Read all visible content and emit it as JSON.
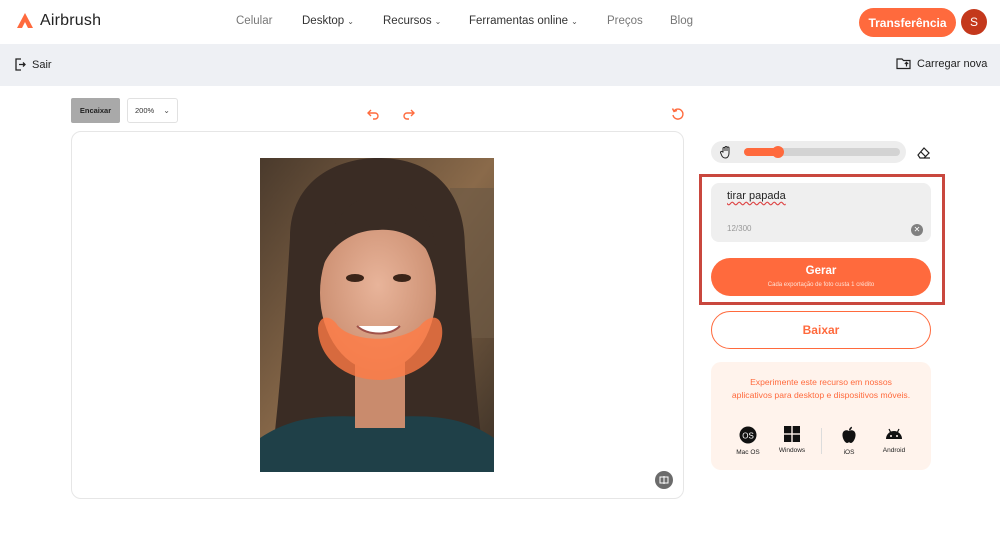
{
  "brand": {
    "name": "Airbrush",
    "color": "#ff6a3d"
  },
  "nav": {
    "items": [
      {
        "label": "Celular",
        "dropdown": false,
        "muted": true
      },
      {
        "label": "Desktop",
        "dropdown": true,
        "muted": false
      },
      {
        "label": "Recursos",
        "dropdown": true,
        "muted": false
      },
      {
        "label": "Ferramentas online",
        "dropdown": true,
        "muted": false
      },
      {
        "label": "Preços",
        "dropdown": false,
        "muted": true
      },
      {
        "label": "Blog",
        "dropdown": false,
        "muted": true
      }
    ],
    "transfer_label": "Transferência",
    "avatar_initial": "S"
  },
  "subbar": {
    "exit_label": "Sair",
    "upload_label": "Carregar nova"
  },
  "toolbar": {
    "fit_label": "Encaixar",
    "zoom_value": "200%"
  },
  "brush": {
    "size_fraction": 0.22
  },
  "prompt": {
    "text": "tirar papada",
    "count": "12/300"
  },
  "generate": {
    "label": "Gerar",
    "note": "Cada exportação de foto custa 1 crédito"
  },
  "download_label": "Baixar",
  "promo": {
    "text": "Experimente este recurso em nossos aplicativos para desktop e dispositivos móveis.",
    "platforms": [
      {
        "label": "Mac OS",
        "icon": "macos-icon"
      },
      {
        "label": "Windows",
        "icon": "windows-icon"
      },
      {
        "label": "iOS",
        "icon": "apple-icon"
      },
      {
        "label": "Android",
        "icon": "android-icon"
      }
    ]
  }
}
